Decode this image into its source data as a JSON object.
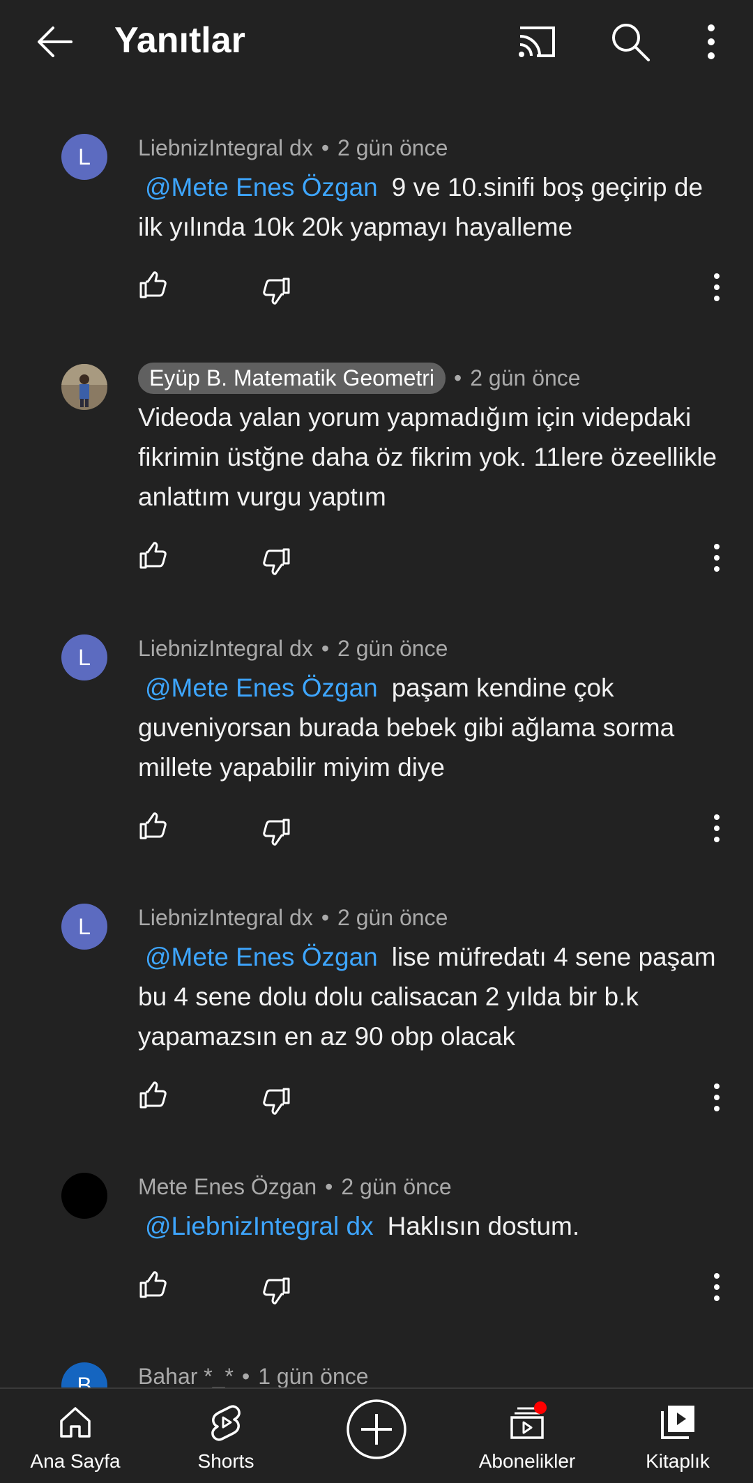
{
  "header": {
    "title": "Yanıtlar"
  },
  "comments": [
    {
      "avatar_letter": "L",
      "avatar_color": "#5c6bc0",
      "author": "LiebnizIntegral dx",
      "time": "2 gün önce",
      "mention": "@Mete Enes Özgan",
      "text": "9 ve 10.sinifi boş geçirip de ilk yılında 10k 20k yapmayı hayalleme"
    },
    {
      "avatar_letter": "",
      "avatar_color": "#7a6a55",
      "author": "Eyüp B. Matematik Geometri",
      "time": "2 gün önce",
      "mention": "",
      "text": "Videoda yalan yorum yapmadığım için videpdaki fikrimin üstğne daha öz fikrim yok. 11lere özeellikle anlattım vurgu yaptım"
    },
    {
      "avatar_letter": "L",
      "avatar_color": "#5c6bc0",
      "author": "LiebnizIntegral dx",
      "time": "2 gün önce",
      "mention": "@Mete Enes Özgan",
      "text": "paşam kendine çok guveniyorsan burada bebek gibi ağlama sorma millete yapabilir miyim diye"
    },
    {
      "avatar_letter": "L",
      "avatar_color": "#5c6bc0",
      "author": "LiebnizIntegral dx",
      "time": "2 gün önce",
      "mention": "@Mete Enes Özgan",
      "text": "lise müfredatı 4 sene paşam bu 4 sene dolu dolu calisacan 2 yılda bir b.k yapamazsın en az 90 obp olacak"
    },
    {
      "avatar_letter": "",
      "avatar_color": "#000000",
      "author": "Mete Enes Özgan",
      "time": "2 gün önce",
      "mention": "@LiebnizIntegral dx",
      "text": "Haklısın dostum."
    },
    {
      "avatar_letter": "B",
      "avatar_color": "#1565c0",
      "author": "Bahar *_*",
      "time": "1 gün önce",
      "mention": "",
      "text": ""
    }
  ],
  "separator": "•",
  "nav": {
    "home": "Ana Sayfa",
    "shorts": "Shorts",
    "subscriptions": "Abonelikler",
    "library": "Kitaplık"
  },
  "colors": {
    "mention": "#3ea6ff",
    "background": "#222222",
    "notification_dot": "#ff0000"
  }
}
